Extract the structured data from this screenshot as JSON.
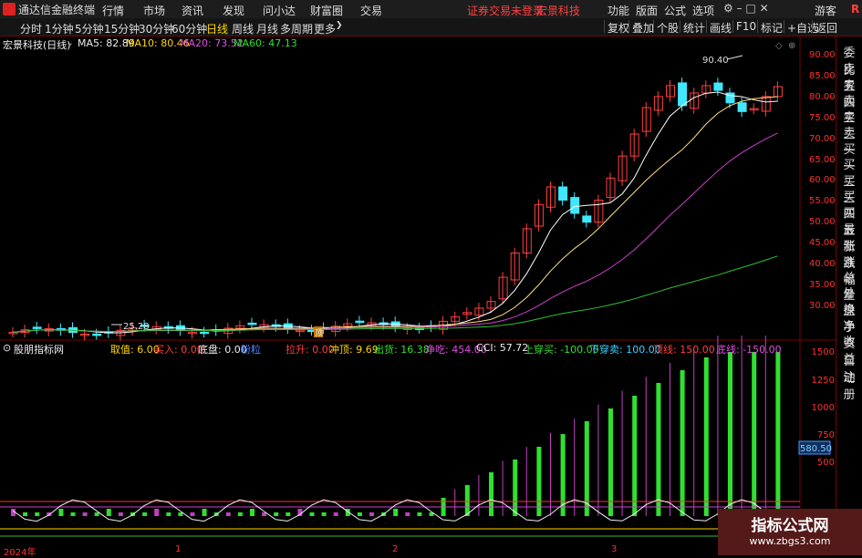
{
  "menubar": {
    "app_title": "通达信金融终端",
    "menus": [
      "行情",
      "市场",
      "资讯",
      "发现",
      "问小达",
      "财富圈",
      "交易"
    ],
    "notice": "证券交易未登录",
    "stock": "宏景科技",
    "right_menus": [
      "功能",
      "版面",
      "公式",
      "选项"
    ],
    "user": "游客"
  },
  "timeframes": [
    "分时",
    "1分钟",
    "5分钟",
    "15分钟",
    "30分钟",
    "60分钟",
    "日线",
    "周线",
    "月线",
    "多周期",
    "更多"
  ],
  "active_timeframe": "日线",
  "toolbar_buttons": [
    "复权",
    "叠加",
    "个股",
    "统计",
    "画线",
    "F10",
    "标记",
    "+自选",
    "返回"
  ],
  "main": {
    "title": "宏景科技(日线)",
    "ma5": "MA5: 82.89",
    "ma10": "MA10: 80.46",
    "ma20": "MA20: 73.52",
    "ma60": "MA60: 47.13",
    "high_label": "90.40",
    "low_label": "25.28",
    "marker": "顶"
  },
  "y_axis_main": [
    "90.00",
    "85.00",
    "80.00",
    "75.00",
    "70.00",
    "65.00",
    "60.00",
    "55.00",
    "50.00",
    "45.00",
    "40.00",
    "35.00",
    "30.00"
  ],
  "y_axis_ind": [
    "1500",
    "1250",
    "1000",
    "750",
    "500"
  ],
  "ind_current": "580.50",
  "indicator": {
    "name": "股朋指标网",
    "items": [
      {
        "t": "取值: 6.00",
        "c": "ylw"
      },
      {
        "t": "买入: 0.00",
        "c": "red"
      },
      {
        "t": "底盘: 0.00",
        "c": "wht"
      },
      {
        "t": "粉粒",
        "c": "blu"
      },
      {
        "t": "拉升: 0.00",
        "c": "red"
      },
      {
        "t": "冲顶: 9.69",
        "c": "ylw"
      },
      {
        "t": "出货: 16.38",
        "c": "grn"
      },
      {
        "t": "净吃: 454.00",
        "c": "mag"
      },
      {
        "t": "CCI: 57.72",
        "c": "wht"
      },
      {
        "t": "上穿买: -100.00",
        "c": "grn"
      },
      {
        "t": "下穿卖: 100.00",
        "c": "cyn"
      },
      {
        "t": "顶线: 150.00",
        "c": "red"
      },
      {
        "t": "底线: -150.00",
        "c": "mag"
      }
    ]
  },
  "sidebar": [
    "委比",
    "卖五",
    "卖四",
    "卖三",
    "卖二",
    "卖一",
    "买一",
    "买二",
    "买三",
    "买四",
    "买五",
    "最新",
    "涨跌",
    "涨幅",
    "总量",
    "外盘",
    "换手",
    "净资",
    "收益",
    "自动",
    "注册"
  ],
  "x_axis": [
    "2024年",
    "1",
    "2",
    "3"
  ],
  "watermark": {
    "line1": "指标公式网",
    "line2": "www.zbgs3.com"
  },
  "colors": {
    "up": "#ff4040",
    "down": "#40e8ff",
    "ma5": "#ffffff",
    "ma10": "#ffe080",
    "ma20": "#d040d0",
    "ma60": "#30c030"
  }
}
